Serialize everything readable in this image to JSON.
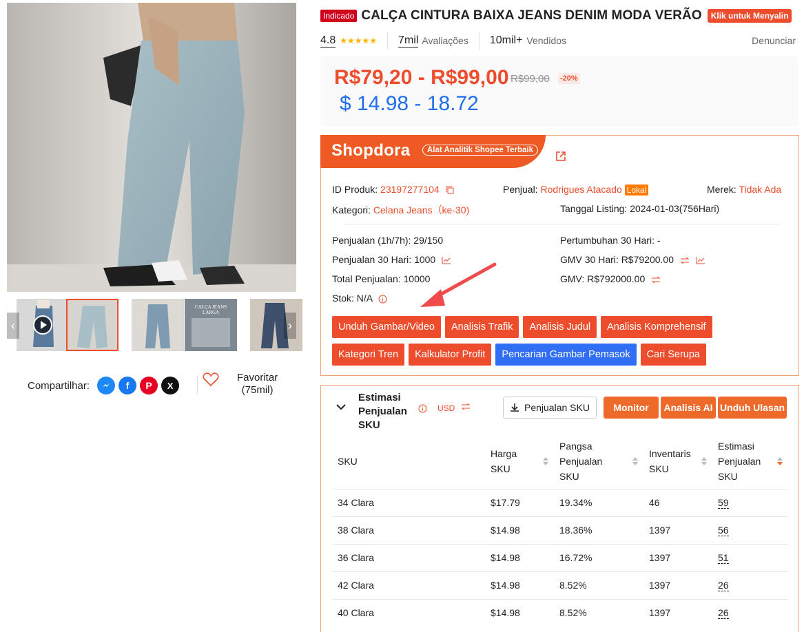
{
  "product": {
    "badge": "Indicado",
    "title": "CALÇA CINTURA BAIXA JEANS DENIM MODA VERÃO",
    "copy_button": "Klik untuk Menyalin",
    "rating": "4.8",
    "reviews_count": "7mil",
    "reviews_label": "Avaliações",
    "sold_count": "10mil+",
    "sold_label": "Vendidos",
    "report_label": "Denunciar",
    "price_range": "R$79,20 - R$99,00",
    "price_original": "R$99,00",
    "discount": "-20%",
    "price_usd": "$ 14.98 - 18.72"
  },
  "gallery": {
    "share_label": "Compartilhar:",
    "favorite_label": "Favoritar",
    "favorite_count": "(75mil)",
    "thumb_text": "CALÇA JEANS LARGA"
  },
  "shopdora": {
    "logo": "Shopdora",
    "tagline": "Alat Analitik Shopee Terbaik",
    "product_id_label": "ID Produk:",
    "product_id": "23197277104",
    "seller_label": "Penjual:",
    "seller": "Rodrigues Atacado",
    "seller_tag": "Lokal",
    "brand_label": "Merek:",
    "brand": "Tidak Ada",
    "category_label": "Kategori:",
    "category": "Celana Jeans（ke-30)",
    "listing_label": "Tanggal Listing:",
    "listing_value": "2024-01-03(756Hari)",
    "sales_1h7h": "Penjualan (1h/7h): 29/150",
    "growth_30": "Pertumbuhan 30 Hari: -",
    "sales_30": "Penjualan 30 Hari: 1000",
    "gmv_30": "GMV 30 Hari: R$79200.00",
    "total_sales": "Total Penjualan: 10000",
    "gmv": "GMV: R$792000.00",
    "stock": "Stok: N/A",
    "buttons_row1": [
      "Unduh Gambar/Video",
      "Analisis Trafik",
      "Analisis Judul",
      "Analisis Komprehensif"
    ],
    "buttons_row2": [
      "Kategori Tren",
      "Kalkulator Profit",
      "Pencarian Gambar Pemasok",
      "Cari Serupa"
    ]
  },
  "sku_estimate": {
    "title": "Estimasi Penjualan SKU",
    "currency": "USD",
    "sku_sales_button": "Penjualan SKU",
    "monitor_button": "Monitor",
    "ai_button": "Analisis AI",
    "download_reviews_button": "Unduh Ulasan",
    "headers": [
      "SKU",
      "Harga SKU",
      "Pangsa Penjualan SKU",
      "Inventaris SKU",
      "Estimasi Penjualan SKU"
    ],
    "rows": [
      {
        "sku": "34 Clara",
        "price": "$17.79",
        "share": "19.34%",
        "inventory": "46",
        "estimate": "59"
      },
      {
        "sku": "38 Clara",
        "price": "$14.98",
        "share": "18.36%",
        "inventory": "1397",
        "estimate": "56"
      },
      {
        "sku": "36 Clara",
        "price": "$14.98",
        "share": "16.72%",
        "inventory": "1397",
        "estimate": "51"
      },
      {
        "sku": "42 Clara",
        "price": "$14.98",
        "share": "8.52%",
        "inventory": "1397",
        "estimate": "26"
      },
      {
        "sku": "40 Clara",
        "price": "$14.98",
        "share": "8.52%",
        "inventory": "1397",
        "estimate": "26"
      }
    ]
  },
  "colors": {
    "accent": "#ee4d2d",
    "usd_blue": "#1f6feb",
    "button_blue": "#2f6ef5"
  }
}
